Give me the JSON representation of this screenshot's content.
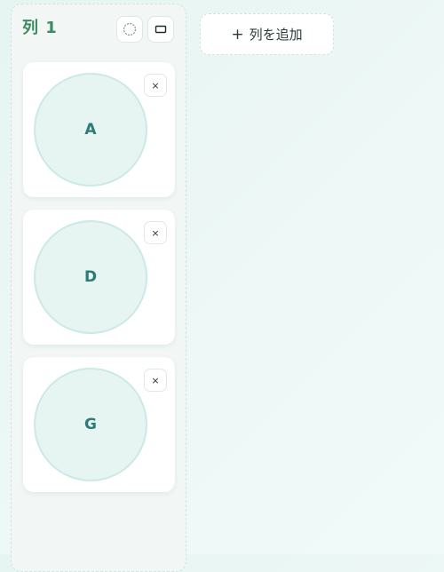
{
  "column": {
    "title": "列 1",
    "circle_button_icon": "circle-outline-icon",
    "rect_button_icon": "rectangle-outline-icon",
    "cards": [
      {
        "label": "A",
        "remove_symbol": "×"
      },
      {
        "label": "D",
        "remove_symbol": "×"
      },
      {
        "label": "G",
        "remove_symbol": "×"
      }
    ]
  },
  "add_column": {
    "icon_symbol": "+",
    "label": "列を追加"
  },
  "colors": {
    "background": "#e6f5f2",
    "column_title": "#3f8a62",
    "card_circle_fill": "#e6f4f2",
    "card_circle_border": "#cbe9e5",
    "card_label": "#2e7a76"
  }
}
